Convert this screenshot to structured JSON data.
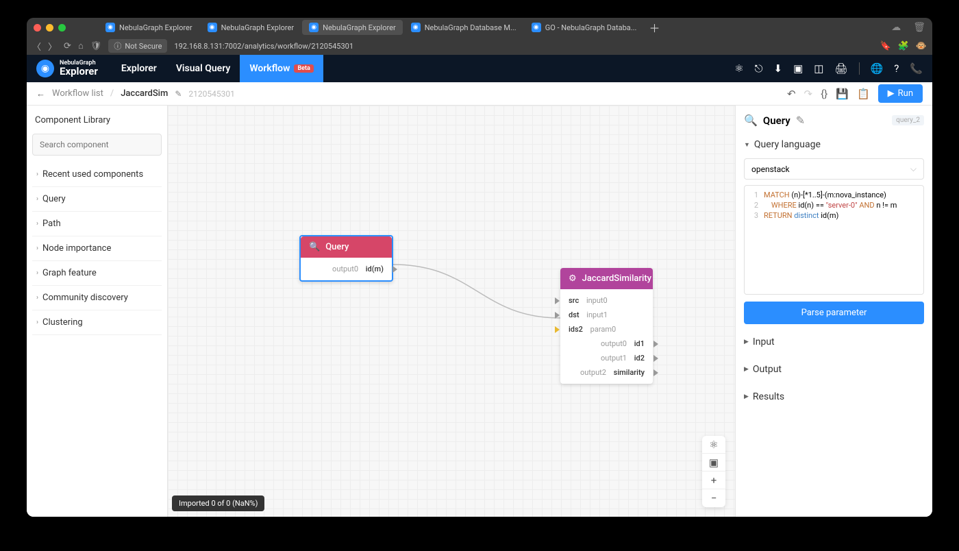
{
  "browser": {
    "tabs": [
      {
        "label": "NebulaGraph Explorer"
      },
      {
        "label": "NebulaGraph Explorer"
      },
      {
        "label": "NebulaGraph Explorer",
        "active": true
      },
      {
        "label": "NebulaGraph Database M..."
      },
      {
        "label": "GO - NebulaGraph Databa..."
      }
    ],
    "not_secure": "Not Secure",
    "url": "192.168.8.131:7002/analytics/workflow/2120545301"
  },
  "app": {
    "logo_line1": "NebulaGraph",
    "logo_line2": "Explorer",
    "nav": {
      "explorer": "Explorer",
      "visual_query": "Visual Query",
      "workflow": "Workflow",
      "beta": "Beta"
    }
  },
  "crumb": {
    "list": "Workflow list",
    "current": "JaccardSim",
    "id": "2120545301",
    "run": "Run"
  },
  "sidebar": {
    "title": "Component Library",
    "search_ph": "Search component",
    "items": [
      "Recent used components",
      "Query",
      "Path",
      "Node importance",
      "Graph feature",
      "Community discovery",
      "Clustering"
    ]
  },
  "nodes": {
    "query": {
      "title": "Query",
      "out_lbl": "output0",
      "out_val": "id(m)"
    },
    "jaccard": {
      "title": "JaccardSimilarity",
      "in0_lbl": "src",
      "in0_v": "input0",
      "in1_lbl": "dst",
      "in1_v": "input1",
      "in2_lbl": "ids2",
      "in2_v": "param0",
      "o0_lbl": "output0",
      "o0_v": "id1",
      "o1_lbl": "output1",
      "o1_v": "id2",
      "o2_lbl": "output2",
      "o2_v": "similarity"
    }
  },
  "toast": "Imported 0 of 0 (NaN%)",
  "rpanel": {
    "title": "Query",
    "id": "query_2",
    "sec_lang": "Query language",
    "select_val": "openstack",
    "code": {
      "l1a": "MATCH",
      "l1b": " (n)-[*1..5]-(m:nova_instance)",
      "l2a": "WHERE",
      "l2b": " id(n) == ",
      "l2c": "\"server-0\"",
      "l2d": " AND",
      "l2e": " n != m",
      "l3a": "RETURN",
      "l3b": " distinct",
      "l3c": " id(m)"
    },
    "parse": "Parse parameter",
    "sec_input": "Input",
    "sec_output": "Output",
    "sec_results": "Results"
  }
}
